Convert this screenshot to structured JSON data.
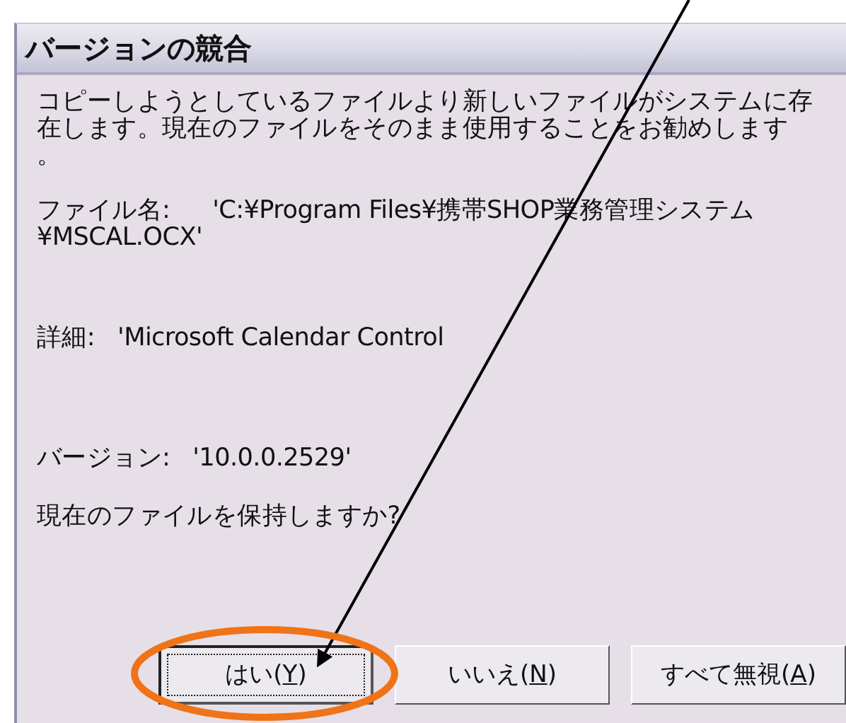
{
  "window": {
    "title": "バージョンの競合"
  },
  "message_lines": [
    "コピーしようとしているファイルより新しいファイルがシステムに存",
    "在します。現在のファイルをそのまま使用することをお勧めします",
    "。"
  ],
  "file": {
    "label": "ファイル名:",
    "value_lines": [
      "'C:¥Program Files¥携帯SHOP業務管理システム",
      "¥MSCAL.OCX'"
    ]
  },
  "details": {
    "label": "詳細:",
    "value": "'Microsoft Calendar Control"
  },
  "version": {
    "label": "バージョン:",
    "value": "'10.0.0.2529'"
  },
  "question": "現在のファイルを保持しますか?",
  "buttons": [
    {
      "label": "はい(",
      "access_key": "Y",
      "label_end": ")",
      "selected": true
    },
    {
      "label": "いいえ(",
      "access_key": "N",
      "label_end": ")",
      "selected": false
    },
    {
      "label": "すべて無視(",
      "access_key": "A",
      "label_end": ")",
      "selected": false
    }
  ]
}
